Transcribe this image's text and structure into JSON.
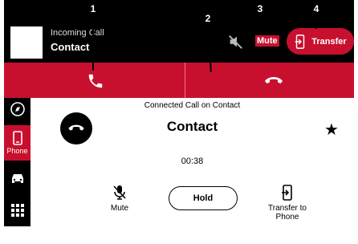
{
  "header": {
    "incoming_label": "Incoming Call",
    "contact": "Contact",
    "mute_label": "Mute",
    "transfer_label": "Transfer"
  },
  "callouts": [
    "1",
    "2",
    "3",
    "4"
  ],
  "sidebar": {
    "items": [
      {
        "icon": "compass-icon",
        "label": ""
      },
      {
        "icon": "phone-icon",
        "label": "Phone",
        "active": true
      },
      {
        "icon": "car-icon",
        "label": ""
      },
      {
        "icon": "grid-icon",
        "label": ""
      }
    ]
  },
  "main": {
    "status": "Connected Call on Contact",
    "contact": "Contact",
    "timer": "00:38",
    "mute_label": "Mute",
    "hold_label": "Hold",
    "transfer_label": "Transfer to Phone"
  },
  "colors": {
    "accent": "#c8102e",
    "dark": "#000000"
  }
}
